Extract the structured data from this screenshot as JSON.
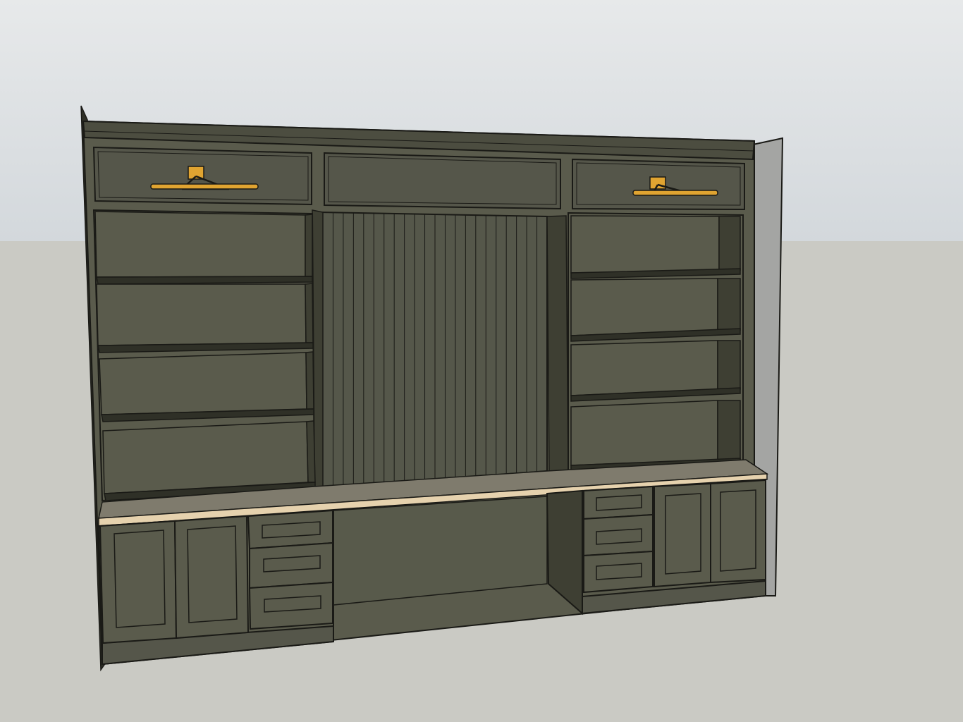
{
  "scene": {
    "subject": "built-in-desk-wall-unit",
    "colors": {
      "sky_top": "#e7e9ea",
      "sky_bottom": "#d3d8dc",
      "ground": "#cacac4",
      "cabinet": "#5a5b4c",
      "cabinet_dark": "#3e3f33",
      "cabinet_shadow": "#2f3027",
      "side_wall": "#a4a5a3",
      "desktop": "#7f7b6d",
      "desktop_edge": "#e6d2ae",
      "brass": "#e0a431",
      "line": "#1a1a16"
    },
    "left_shelf_count": 4,
    "right_shelf_count": 4,
    "beadboard_slat_count": 22,
    "lower_left_doors": 2,
    "lower_left_drawers": 3,
    "lower_right_doors": 2,
    "lower_right_drawers": 3,
    "picture_lights": 2
  }
}
